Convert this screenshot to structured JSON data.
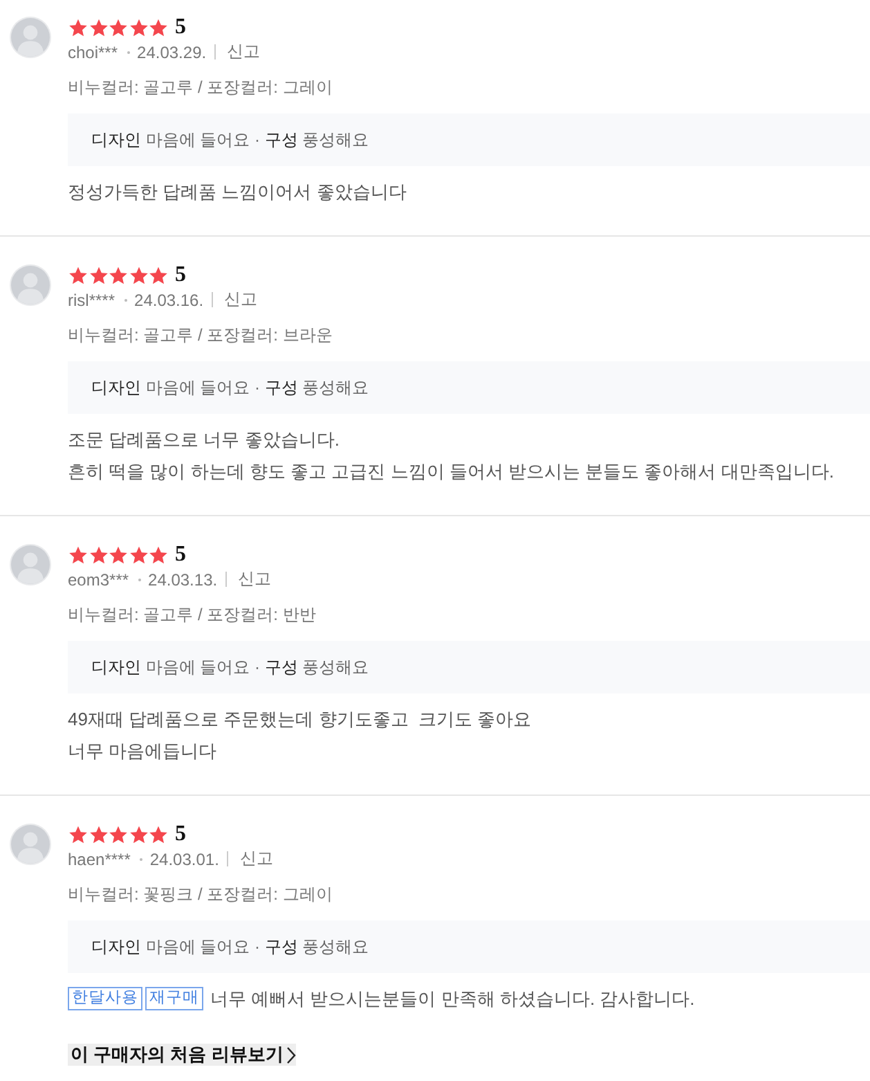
{
  "reviews": [
    {
      "stars": 5,
      "rating": "5",
      "author": "choi***",
      "date": "24.03.29.",
      "report": "신고",
      "option": "비누컬러: 골고루 / 포장컬러: 그레이",
      "keywords": "**디자인** 마음에 들어요 · **구성** 풍성해요",
      "body": "정성가득한 답례품 느낌이어서 좋았습니다"
    },
    {
      "stars": 5,
      "rating": "5",
      "author": "risl****",
      "date": "24.03.16.",
      "report": "신고",
      "option": "비누컬러: 골고루 / 포장컬러: 브라운",
      "keywords": "**디자인** 마음에 들어요 · **구성** 풍성해요",
      "body": "조문 답례품으로 너무 좋았습니다.\n흔히 떡을 많이 하는데 향도 좋고 고급진 느낌이 들어서 받으시는 분들도 좋아해서 대만족입니다."
    },
    {
      "stars": 5,
      "rating": "5",
      "author": "eom3***",
      "date": "24.03.13.",
      "report": "신고",
      "option": "비누컬러: 골고루 / 포장컬러: 반반",
      "keywords": "**디자인** 마음에 들어요 · **구성** 풍성해요",
      "body": "49재때 답례품으로 주문했는데 향기도좋고  크기도 좋아요\n너무 마음에듭니다"
    },
    {
      "stars": 5,
      "rating": "5",
      "author": "haen****",
      "date": "24.03.01.",
      "report": "신고",
      "option": "비누컬러: 꽃핑크 / 포장컬러: 그레이",
      "keywords": "**디자인** 마음에 들어요 · **구성** 풍성해요",
      "tags": [
        "한달사용",
        "재구매"
      ],
      "body": "너무 예뻐서 받으시는분들이 만족해 하셨습니다. 감사합니다.",
      "first_review_link": "이 구매자의 처음 리뷰보기"
    }
  ]
}
